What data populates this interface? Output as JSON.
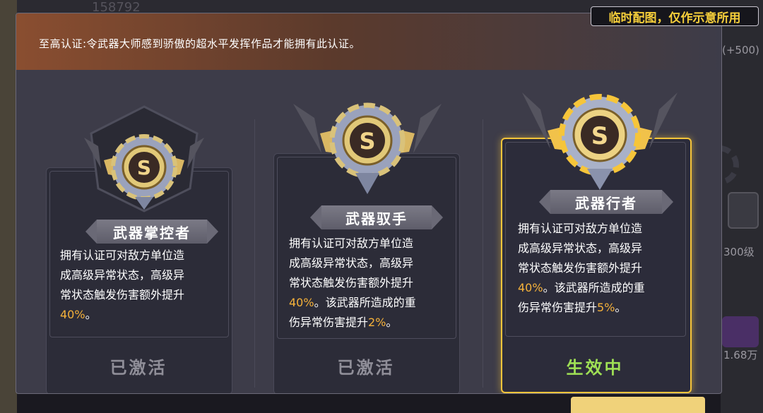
{
  "background": {
    "top_number": "158792",
    "right_plus": "(+500)",
    "right_level": "300级",
    "right_value": "1.68万"
  },
  "watermark": "临时配图，仅作示意所用",
  "header": {
    "description": "至高认证:令武器大师感到骄傲的超水平发挥作品才能拥有此认证。"
  },
  "cards": [
    {
      "title": "武器掌控者",
      "desc_lines": [
        "拥有认证可对敌方单位造",
        "成高级异常状态，高级异",
        "常状态触发伤害额外提升"
      ],
      "bonus_value": "40%",
      "bonus_suffix": "。",
      "status": "已激活",
      "badge_icon": "s-rank-gear-icon"
    },
    {
      "title": "武器驭手",
      "desc_lines": [
        "拥有认证可对敌方单位造",
        "成高级异常状态，高级异",
        "常状态触发伤害额外提升"
      ],
      "bonus_value": "40%",
      "bonus_suffix": "。该武器所造成的重",
      "line5_prefix": "伤异常伤害提升",
      "line5_value": "2%",
      "line5_suffix": "。",
      "status": "已激活",
      "badge_icon": "s-rank-gear-icon"
    },
    {
      "title": "武器行者",
      "desc_lines": [
        "拥有认证可对敌方单位造",
        "成高级异常状态，高级异",
        "常状态触发伤害额外提升"
      ],
      "bonus_value": "40%",
      "bonus_suffix": "。该武器所造成的重",
      "line5_prefix": "伤异常伤害提升",
      "line5_value": "5%",
      "line5_suffix": "。",
      "status": "生效中",
      "badge_icon": "s-rank-gear-glowing-icon"
    }
  ],
  "colors": {
    "highlight": "#f6b23a",
    "active_border": "#f6c53a",
    "active_status": "#9fe055",
    "inactive_status": "#8f8e98"
  }
}
